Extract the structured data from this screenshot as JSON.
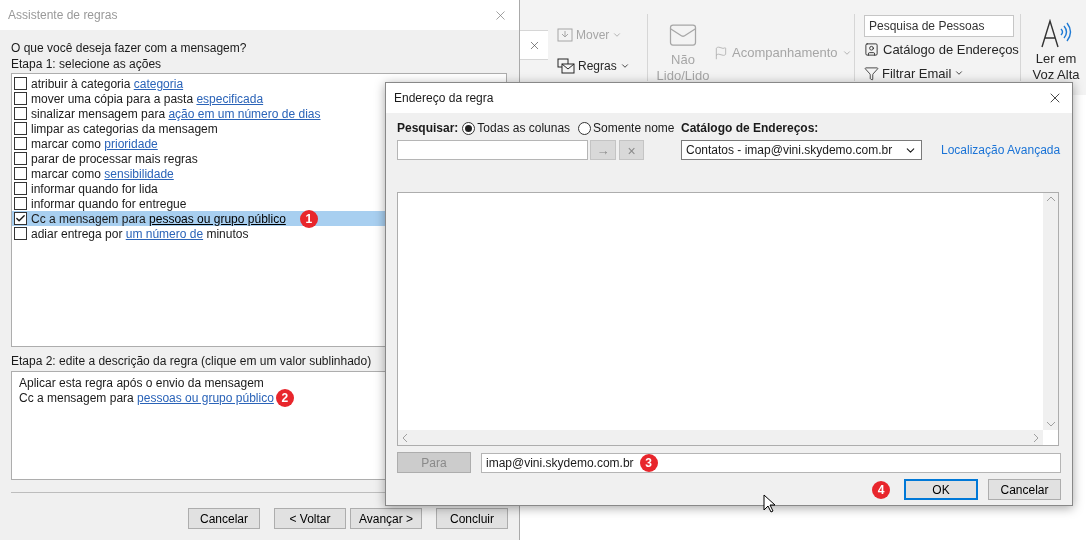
{
  "ribbon": {
    "move": {
      "label": "Mover",
      "disabled": true
    },
    "rules": {
      "label": "Regras",
      "disabled": false
    },
    "read_unread": {
      "label_lines": [
        "Não",
        "Lido/Lido"
      ],
      "disabled": true
    },
    "follow_up": {
      "label": "Acompanhamento",
      "disabled": true
    },
    "people_search": {
      "placeholder": "Pesquisa de Pessoas"
    },
    "address_book": {
      "label": "Catálogo de Endereços"
    },
    "filter_email": {
      "label": "Filtrar Email"
    },
    "read_aloud": {
      "label_lines": [
        "Ler em",
        "Voz Alta"
      ]
    }
  },
  "rules_wizard": {
    "title": "Assistente de regras",
    "question": "O que você deseja fazer com a mensagem?",
    "step1_label": "Etapa 1: selecione as ações",
    "actions": [
      {
        "text": "atribuir à categoria ",
        "link": "categoria",
        "checked": false,
        "selected": false
      },
      {
        "text": "mover uma cópia para a pasta ",
        "link": "especificada",
        "checked": false,
        "selected": false
      },
      {
        "text": "sinalizar mensagem para ",
        "link": "ação em um número de dias",
        "checked": false,
        "selected": false
      },
      {
        "text": "limpar as categorias da mensagem",
        "checked": false,
        "selected": false
      },
      {
        "text": "marcar como ",
        "link": "prioridade",
        "checked": false,
        "selected": false
      },
      {
        "text": "parar de processar mais regras",
        "checked": false,
        "selected": false
      },
      {
        "text": "marcar como ",
        "link": "sensibilidade",
        "checked": false,
        "selected": false
      },
      {
        "text": "informar quando for lida",
        "checked": false,
        "selected": false
      },
      {
        "text": "informar quando for entregue",
        "checked": false,
        "selected": false
      },
      {
        "text": "Cc a mensagem para ",
        "link": "pessoas ou grupo público",
        "checked": true,
        "selected": true,
        "badge": "1"
      },
      {
        "text": "adiar entrega por ",
        "link": "um número de",
        "after": " minutos",
        "checked": false,
        "selected": false
      }
    ],
    "step2_label": "Etapa 2: edite a descrição da regra (clique em um valor sublinhado)",
    "description": [
      {
        "text": "Aplicar esta regra após o envio da mensagem"
      },
      {
        "text": "Cc a mensagem para ",
        "link": "pessoas ou grupo público",
        "badge": "2"
      }
    ],
    "buttons": [
      "Cancelar",
      "< Voltar",
      "Avançar >",
      "Concluir"
    ]
  },
  "address_dialog": {
    "title": "Endereço da regra",
    "search_label": "Pesquisar:",
    "search_scope": [
      {
        "label": "Todas as colunas",
        "selected": true
      },
      {
        "label": "Somente nome",
        "selected": false
      }
    ],
    "go_button": {
      "label": "→",
      "disabled": true
    },
    "clear_button": {
      "label": "×",
      "disabled": true
    },
    "address_book_label": "Catálogo de Endereços:",
    "address_book_value": "Contatos - imap@vini.skydemo.com.br",
    "advanced_link": "Localização Avançada",
    "to_button": {
      "label": "Para",
      "disabled": true
    },
    "to_value": "imap@vini.skydemo.com.br",
    "to_badge": "3",
    "ok_badge": "4",
    "ok_button": {
      "label": "OK",
      "default": true
    },
    "cancel_button": "Cancelar"
  }
}
